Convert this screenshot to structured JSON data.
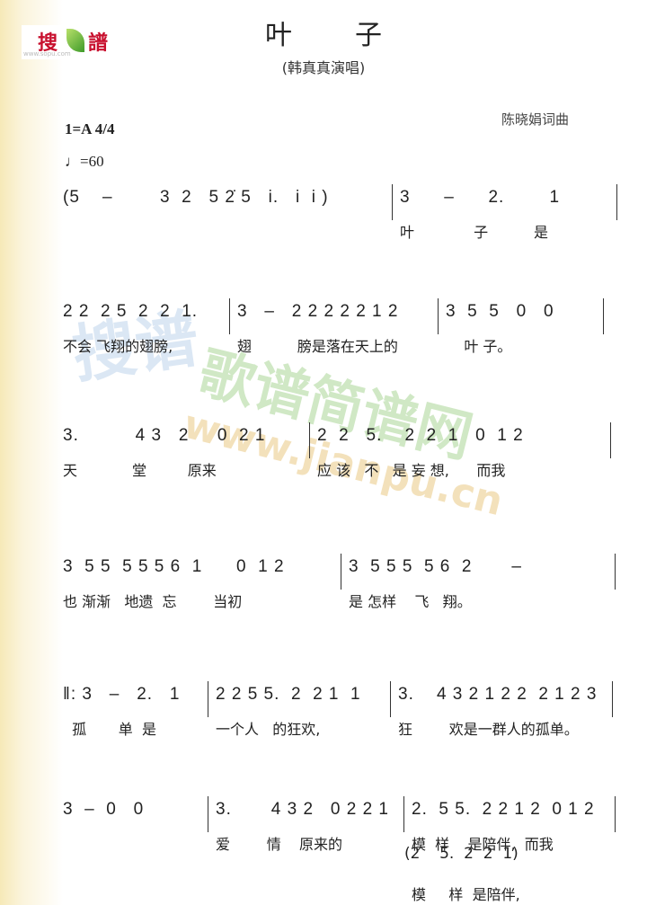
{
  "logo": {
    "text_left": "搜",
    "text_right": "譜",
    "url": "www.sopu.com"
  },
  "title": "叶子",
  "subtitle": "(韩真真演唱)",
  "composer": "陈晓娟词曲",
  "key": "1=A 4/4",
  "tempo": "♩=60",
  "watermark": {
    "cn": "歌谱简谱网",
    "url": "www.jianpu.cn",
    "left": "搜谱"
  },
  "rows": [
    {
      "measures": [
        {
          "notes": "(5    –",
          "lyrics": ""
        },
        {
          "notes": "3  2   5 2̇ 5   i.   i  i )",
          "lyrics": ""
        },
        {
          "notes": "3      –      2.        1",
          "lyrics": "叶             子          是"
        }
      ]
    },
    {
      "measures": [
        {
          "notes": "2 2  2 5  2  2  1.",
          "lyrics": "不会 飞翔的翅膀,"
        },
        {
          "notes": "3   –   2 2 2 2 2 1 2",
          "lyrics": "翅          膀是落在天上的"
        },
        {
          "notes": "3  5  5   0   0",
          "lyrics": "    叶 子。"
        }
      ]
    },
    {
      "measures": [
        {
          "notes": "3.          4 3   2     0  2 1",
          "lyrics": "天            堂         原来"
        },
        {
          "notes": "2  2   5.    2  2  1   0  1 2",
          "lyrics": "应 该   不   是 妄 想,      而我"
        }
      ]
    },
    {
      "measures": [
        {
          "notes": "3  5 5  5 5 5 6  1      0  1 2",
          "lyrics": "也 渐渐   地遗  忘        当初"
        },
        {
          "notes": "3  5 5 5  5 6  2       –",
          "lyrics": "是 怎样    飞   翔。"
        }
      ]
    },
    {
      "measures": [
        {
          "notes": "‖: 3   –   2.   1",
          "lyrics": "  孤       单  是"
        },
        {
          "notes": "2 2 5 5.  2  2 1  1",
          "lyrics": "一个人   的狂欢,"
        },
        {
          "notes": "3.    4 3 2 1 2 2  2 1 2 3",
          "lyrics": "狂        欢是一群人的孤单。"
        }
      ]
    },
    {
      "measures": [
        {
          "notes": "3  –  0   0",
          "lyrics": ""
        },
        {
          "notes": "3.       4 3 2   0 2 2 1",
          "lyrics": "爱        情    原来的"
        },
        {
          "notes": "2.  5 5.  2 2 1 2  0 1 2",
          "lyrics": "模  样    是陪伴,  而我"
        }
      ]
    }
  ],
  "alt_notes": "(2    5.  2  2  1)",
  "alt_lyrics": "模     样  是陪伴,"
}
